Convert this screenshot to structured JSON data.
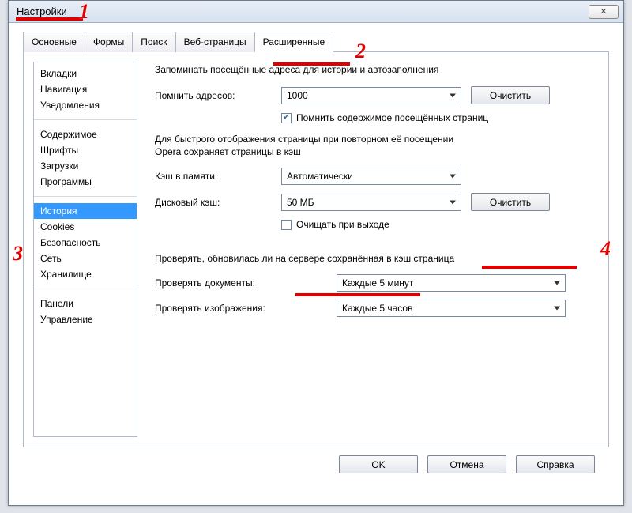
{
  "window": {
    "title": "Настройки"
  },
  "tabs": [
    "Основные",
    "Формы",
    "Поиск",
    "Веб-страницы",
    "Расширенные"
  ],
  "active_tab_index": 4,
  "sidebar": {
    "groups": [
      [
        "Вкладки",
        "Навигация",
        "Уведомления"
      ],
      [
        "Содержимое",
        "Шрифты",
        "Загрузки",
        "Программы"
      ],
      [
        "История",
        "Cookies",
        "Безопасность",
        "Сеть",
        "Хранилище"
      ],
      [
        "Панели",
        "Управление"
      ]
    ],
    "selected": "История"
  },
  "history": {
    "heading": "Запоминать посещённые адреса для истории и автозаполнения",
    "remember_label": "Помнить адресов:",
    "remember_value": "1000",
    "clear_btn": "Очистить",
    "remember_content_checked": true,
    "remember_content_label": "Помнить содержимое посещённых страниц",
    "cache_para1": "Для быстрого отображения страницы при повторном её посещении",
    "cache_para2": "Opera сохраняет страницы в кэш",
    "mem_cache_label": "Кэш в памяти:",
    "mem_cache_value": "Автоматически",
    "disk_cache_label": "Дисковый кэш:",
    "disk_cache_value": "50 МБ",
    "clear_disk_btn": "Очистить",
    "clear_on_exit_checked": false,
    "clear_on_exit_label": "Очищать при выходе",
    "check_heading": "Проверять, обновилась ли на сервере сохранённая в кэш страница",
    "check_docs_label": "Проверять документы:",
    "check_docs_value": "Каждые 5 минут",
    "check_imgs_label": "Проверять изображения:",
    "check_imgs_value": "Каждые 5 часов"
  },
  "buttons": {
    "ok": "OK",
    "cancel": "Отмена",
    "help": "Справка"
  },
  "annotations": {
    "n1": "1",
    "n2": "2",
    "n3": "3",
    "n4": "4"
  }
}
